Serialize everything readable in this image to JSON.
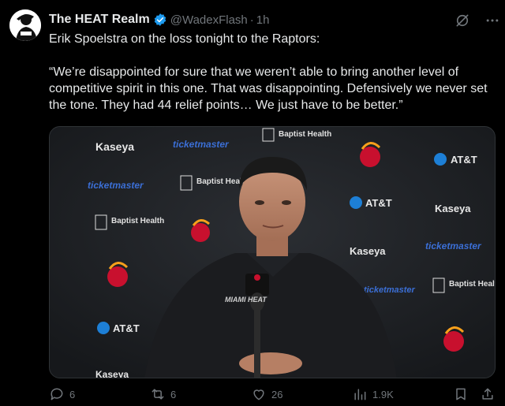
{
  "post": {
    "author_name": "The HEAT Realm",
    "handle": "@WadexFlash",
    "separator": "·",
    "time": "1h",
    "paragraph_1": "Erik Spoelstra on the loss tonight to the Raptors:",
    "paragraph_2": "“We’re disappointed for sure that we weren’t able to bring another level of competitive spirit in this one. That was disappointing. Defensively we never set the tone. They had 44 relief points… We just have to be better.”"
  },
  "media": {
    "backdrop_logos": [
      "Kaseya",
      "ticketmaster",
      "Baptist Health",
      "AT&T"
    ],
    "mic_label": "MIAMI HEAT"
  },
  "actions": {
    "replies": "6",
    "reposts": "6",
    "likes": "26",
    "views": "1.9K"
  },
  "colors": {
    "accent": "#1d9bf0",
    "muted": "#71767b",
    "heat_red": "#c8102e"
  }
}
